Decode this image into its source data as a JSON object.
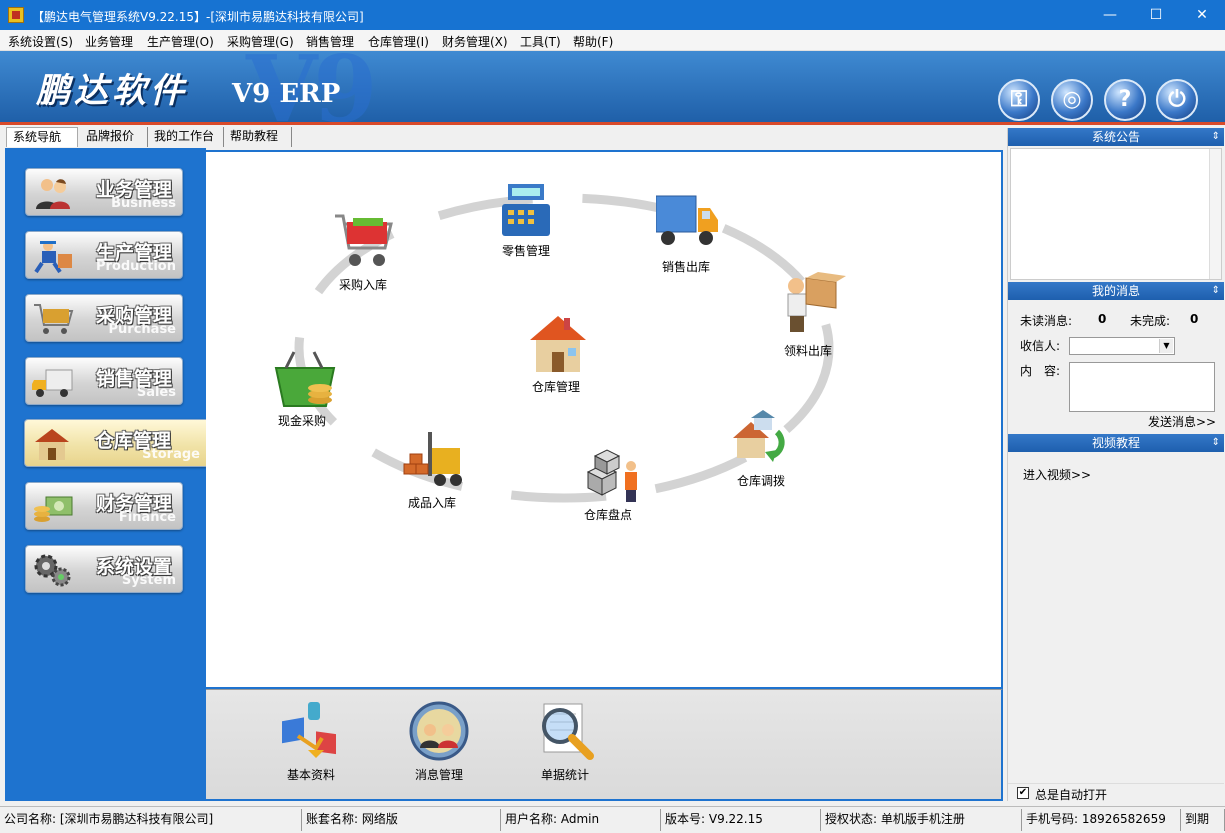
{
  "window": {
    "title": "【鹏达电气管理系统V9.22.15】-[深圳市易鹏达科技有限公司]",
    "min": "—",
    "max": "☐",
    "close": "✕"
  },
  "menu": [
    "系统设置(S)",
    "业务管理",
    "生产管理(O)",
    "采购管理(G)",
    "销售管理",
    "仓库管理(I)",
    "财务管理(X)",
    "工具(T)",
    "帮助(F)"
  ],
  "banner": {
    "logo": "鹏达软件",
    "product": "V9 ERP",
    "watermark": "V9"
  },
  "toolbar_icons": [
    "key-icon",
    "support-icon",
    "help-icon",
    "power-icon"
  ],
  "tabs": [
    "系统导航",
    "品牌报价",
    "我的工作台",
    "帮助教程"
  ],
  "nav": [
    {
      "cn": "业务管理",
      "en": "Business",
      "icon": "people-icon"
    },
    {
      "cn": "生产管理",
      "en": "Production",
      "icon": "worker-icon"
    },
    {
      "cn": "采购管理",
      "en": "Purchase",
      "icon": "cart-icon"
    },
    {
      "cn": "销售管理",
      "en": "Sales",
      "icon": "truck-icon"
    },
    {
      "cn": "仓库管理",
      "en": "Storage",
      "icon": "house-icon"
    },
    {
      "cn": "财务管理",
      "en": "Finance",
      "icon": "money-icon"
    },
    {
      "cn": "系统设置",
      "en": "System",
      "icon": "gears-icon"
    }
  ],
  "flow": {
    "retail": "零售管理",
    "purchase_in": "采购入库",
    "sales_out": "销售出库",
    "material_out": "领料出库",
    "warehouse": "仓库管理",
    "cash_purchase": "现金采购",
    "transfer": "仓库调拨",
    "product_in": "成品入库",
    "inventory": "仓库盘点"
  },
  "bottom": {
    "basic": "基本资料",
    "message": "消息管理",
    "stats": "单据统计"
  },
  "right": {
    "notice_title": "系统公告",
    "msg_title": "我的消息",
    "unread_label": "未读消息:",
    "unread_value": "0",
    "unfinished_label": "未完成:",
    "unfinished_value": "0",
    "receiver_label": "收信人:",
    "content_label": "内　容:",
    "send": "发送消息>>",
    "video_title": "视频教程",
    "enter_video": "进入视频>>",
    "auto_open": "总是自动打开"
  },
  "status": {
    "company": "公司名称: [深圳市易鹏达科技有限公司]",
    "account": "账套名称: 网络版",
    "user": "用户名称: Admin",
    "version": "版本号: V9.22.15",
    "license": "授权状态: 单机版手机注册",
    "phone": "手机号码: 18926582659",
    "expire": "到期"
  }
}
